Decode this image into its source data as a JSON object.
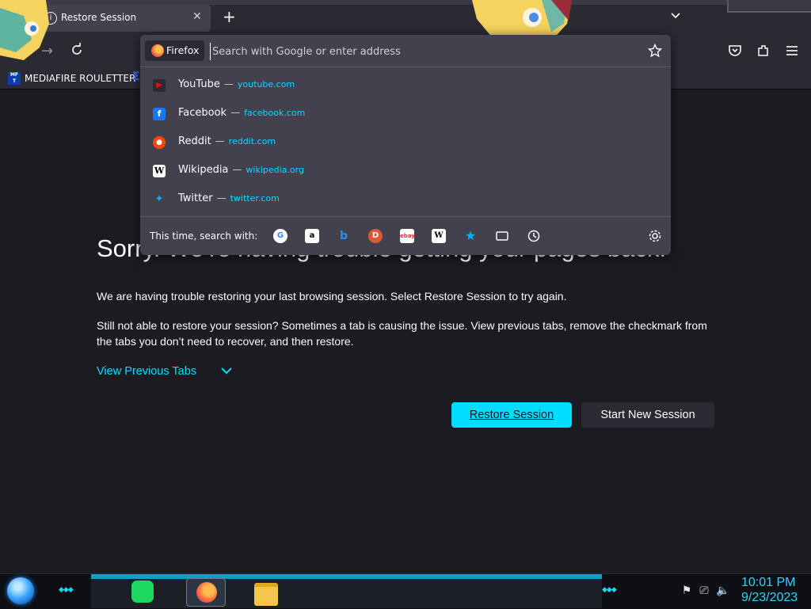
{
  "tab": {
    "title": "Restore Session"
  },
  "bookmarks": [
    {
      "label": "MEDIAFIRE ROULETTER",
      "icon_text": "MF\nT"
    }
  ],
  "urlbar": {
    "identity_label": "Firefox",
    "placeholder": "Search with Google or enter address",
    "suggestions": [
      {
        "title": "YouTube",
        "url": "youtube.com",
        "icon": "youtube-icon",
        "color": "#ff0000"
      },
      {
        "title": "Facebook",
        "url": "facebook.com",
        "icon": "facebook-icon",
        "color": "#1877f2"
      },
      {
        "title": "Reddit",
        "url": "reddit.com",
        "icon": "reddit-icon",
        "color": "#ff4500"
      },
      {
        "title": "Wikipedia",
        "url": "wikipedia.org",
        "icon": "wikipedia-icon",
        "color": "#ffffff"
      },
      {
        "title": "Twitter",
        "url": "twitter.com",
        "icon": "twitter-icon",
        "color": "#1da1f2"
      }
    ],
    "separator": "—",
    "search_with_label": "This time, search with:",
    "engines": [
      "google-icon",
      "amazon-icon",
      "bing-icon",
      "duckduckgo-icon",
      "ebay-icon",
      "wikipedia-icon",
      "bookmarks-star-icon",
      "tabs-icon",
      "history-icon"
    ]
  },
  "content": {
    "title": "Sorry. We’re having trouble getting your pages back.",
    "p1": "We are having trouble restoring your last browsing session. Select Restore Session to try again.",
    "p2": "Still not able to restore your session? Sometimes a tab is causing the issue. View previous tabs, remove the checkmark from the tabs you don’t need to recover, and then restore.",
    "view_previous": "View Previous Tabs",
    "restore_button": "Restore Session",
    "new_session_button": "Start New Session"
  },
  "taskbar": {
    "time": "10:01 PM",
    "date": "9/23/2023"
  },
  "colors": {
    "accent": "#00ddff",
    "background": "#1c1b22",
    "toolbar": "#2b2a33",
    "popup": "#42414d",
    "clock": "#2ed3f5"
  }
}
